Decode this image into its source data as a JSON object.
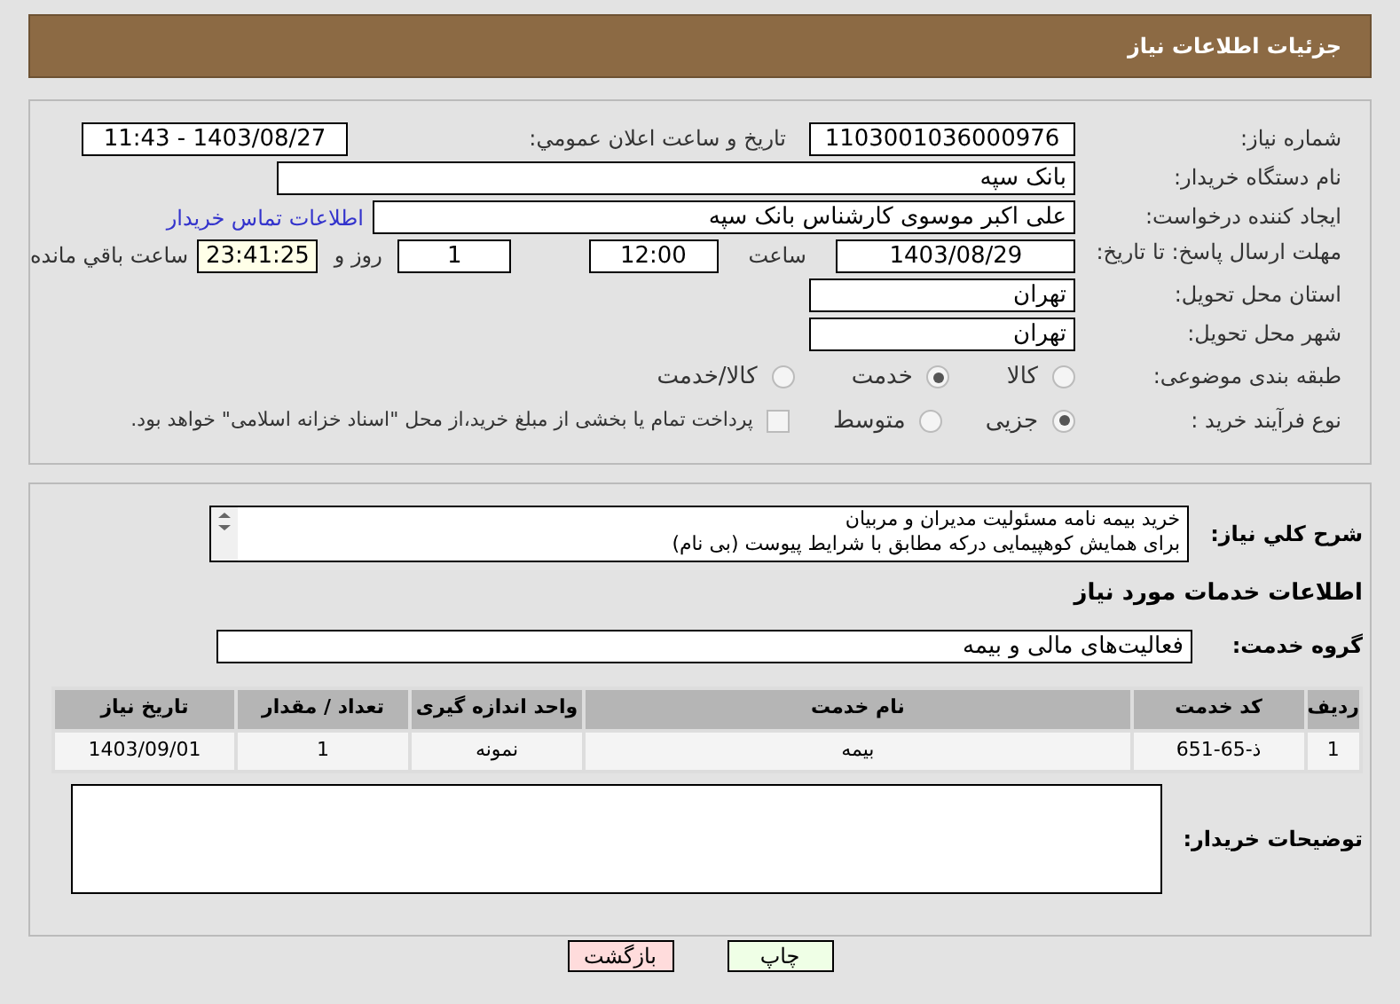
{
  "header": {
    "title": "جزئیات اطلاعات نیاز"
  },
  "form": {
    "need_number": {
      "label": "شماره نیاز:",
      "value": "1103001036000976"
    },
    "announce": {
      "label": "تاریخ و ساعت اعلان عمومي:",
      "value": "1403/08/27 - 11:43"
    },
    "buyer_org": {
      "label": "نام دستگاه خریدار:",
      "value": "بانک سپه"
    },
    "creator": {
      "label": "ایجاد کننده درخواست:",
      "value": "علی اکبر موسوی کارشناس بانک سپه",
      "link": "اطلاعات تماس خریدار"
    },
    "deadline": {
      "label": "مهلت ارسال پاسخ: تا تاریخ:",
      "date": "1403/08/29",
      "time_label": "ساعت",
      "time": "12:00",
      "days": "1",
      "days_label": "روز و",
      "remaining": "23:41:25",
      "remaining_label": "ساعت باقي مانده"
    },
    "province": {
      "label": "استان محل تحویل:",
      "value": "تهران"
    },
    "city": {
      "label": "شهر محل تحویل:",
      "value": "تهران"
    },
    "category": {
      "label": "طبقه بندی موضوعی:",
      "options": [
        {
          "label": "کالا",
          "selected": false
        },
        {
          "label": "خدمت",
          "selected": true
        },
        {
          "label": "کالا/خدمت",
          "selected": false
        }
      ]
    },
    "process": {
      "label": "نوع فرآیند خرید :",
      "options": [
        {
          "label": "جزیی",
          "selected": true
        },
        {
          "label": "متوسط",
          "selected": false
        }
      ],
      "payment": {
        "label": "پرداخت تمام یا بخشی از مبلغ خرید،از محل \"اسناد خزانه اسلامی\" خواهد بود.",
        "checked": false
      }
    }
  },
  "details": {
    "summary_label": "شرح کلي نیاز:",
    "summary_lines": [
      "خرید بیمه نامه مسئولیت مدیران و مربیان",
      "برای همایش کوهپیمایی درکه مطابق با شرایط پیوست (بی نام)"
    ],
    "services_heading": "اطلاعات خدمات مورد نیاز",
    "group_label": "گروه خدمت:",
    "group_value": "فعالیت‌های مالی و بیمه",
    "table": {
      "columns": [
        "ردیف",
        "کد خدمت",
        "نام خدمت",
        "واحد اندازه گیری",
        "تعداد / مقدار",
        "تاریخ نیاز"
      ],
      "rows": [
        [
          "1",
          "ذ-65-651",
          "بیمه",
          "نمونه",
          "1",
          "1403/09/01"
        ]
      ]
    },
    "notes_label": "توضیحات خریدار:"
  },
  "buttons": [
    {
      "label": "چاپ",
      "kind": "print"
    },
    {
      "label": "بازگشت",
      "kind": "back"
    }
  ]
}
